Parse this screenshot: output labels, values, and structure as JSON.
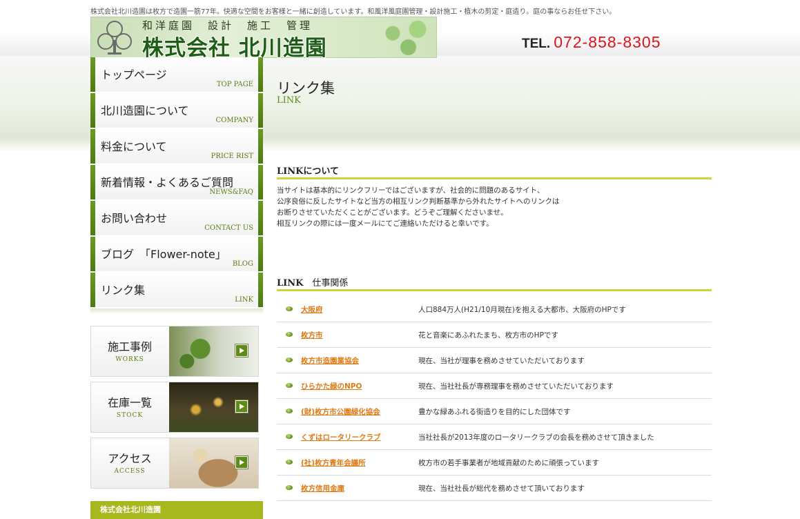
{
  "header": {
    "tagline": "株式会社北川造園は枚方で造園一筋77年。快適な空間をお客様と一緒に創造しています。和風洋風庭園管理・設計施工・植木の剪定・庭造り。庭の事ならお任せ下さい。",
    "logo_sub": "和洋庭園　設計　施工　管理",
    "logo_main": "株式会社 北川造園",
    "tel_label": "TEL.",
    "tel_number": "072-858-8305"
  },
  "nav": {
    "items": [
      {
        "jp": "トップページ",
        "en": "TOP PAGE"
      },
      {
        "jp": "北川造園について",
        "en": "COMPANY"
      },
      {
        "jp": "料金について",
        "en": "PRICE RIST"
      },
      {
        "jp": "新着情報・よくあるご質問",
        "en": "NEWS&FAQ"
      },
      {
        "jp": "お問い合わせ",
        "en": "CONTACT US"
      },
      {
        "jp": "ブログ　「Flower-note」",
        "en": "BLOG"
      },
      {
        "jp": "リンク集",
        "en": "LINK"
      }
    ]
  },
  "banners": [
    {
      "jp": "施工事例",
      "en": "WORKS"
    },
    {
      "jp": "在庫一覧",
      "en": "STOCK"
    },
    {
      "jp": "アクセス",
      "en": "ACCESS"
    }
  ],
  "sidebar_footer": "株式会社北川造園",
  "page": {
    "title": "リンク集",
    "title_en": "LINK"
  },
  "about": {
    "heading": "LINKについて",
    "lines": [
      "当サイトは基本的にリンクフリーではございますが、社会的に問題のあるサイト、",
      "公序良俗に反したサイトなど当方の相互リンク判断基準から外れたサイトへのリンクは",
      "お断りさせていただくことがございます。どうぞご理解くださいませ。",
      "相互リンクの際には一度メールにてご連絡いただけると幸いです。"
    ]
  },
  "links_section": {
    "heading_a": "LINK",
    "heading_b": "仕事関係",
    "items": [
      {
        "name": "大阪府",
        "desc": "人口884万人(H21/10月現在)を抱える大都市、大阪府のHPです"
      },
      {
        "name": "枚方市",
        "desc": "花と音楽にあふれたまち、枚方市のHPです"
      },
      {
        "name": "枚方市造園業協会",
        "desc": "現在、当社が理事を務めさせていただいております"
      },
      {
        "name": "ひらかた緑のNPO",
        "desc": "現在、当社社長が専務理事を務めさせていただいております"
      },
      {
        "name": "(財)枚方市公園緑化協会",
        "desc": "豊かな緑あふれる街造りを目的にした団体です"
      },
      {
        "name": "くずはロータリークラブ",
        "desc": "当社社長が2013年度のロータリークラブの会長を務めさせて頂きました"
      },
      {
        "name": "(社)枚方青年会議所",
        "desc": "枚方市の若手事業者が地域貢献のために頑張っています"
      },
      {
        "name": "枚方信用金庫",
        "desc": "現在、当社社長が総代を務めさせて頂いております"
      }
    ]
  }
}
